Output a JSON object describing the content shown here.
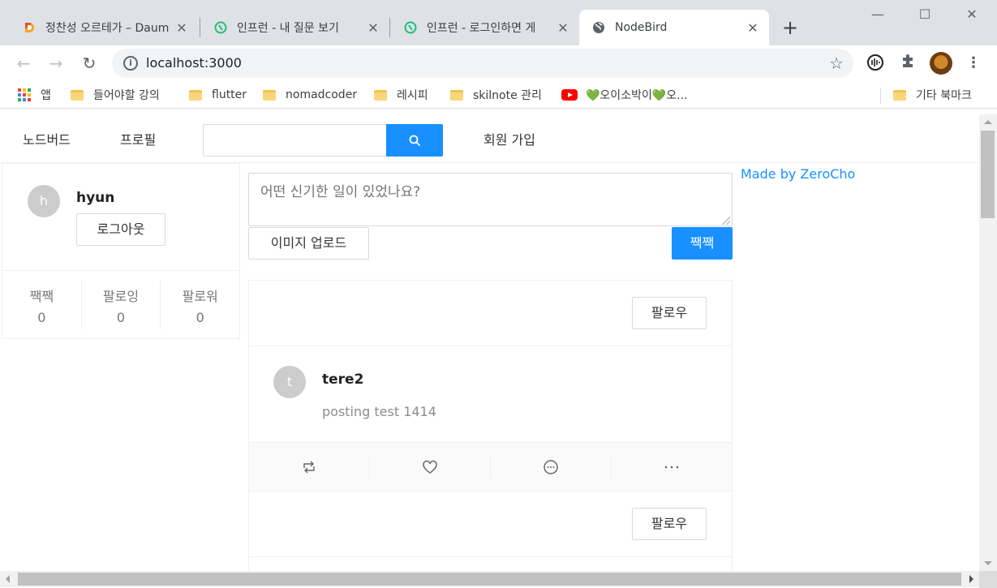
{
  "browser": {
    "tabs": [
      {
        "title": "정찬성 오르테가 – Daum",
        "favicon": "daum-icon"
      },
      {
        "title": "인프런 - 내 질문 보기",
        "favicon": "inflearn-icon"
      },
      {
        "title": "인프런 - 로그인하면 게",
        "favicon": "inflearn-icon"
      },
      {
        "title": "NodeBird",
        "favicon": "globe-icon"
      }
    ],
    "url": "localhost:3000",
    "bookmarks": [
      {
        "label": "앱",
        "icon": "apps-icon"
      },
      {
        "label": "들어야할 강의",
        "icon": "folder-icon"
      },
      {
        "label": "flutter",
        "icon": "folder-icon"
      },
      {
        "label": "nomadcoder",
        "icon": "folder-icon"
      },
      {
        "label": "레시피",
        "icon": "folder-icon"
      },
      {
        "label": "skilnote 관리",
        "icon": "folder-icon"
      },
      {
        "label": "💚오이소박이💚오...",
        "icon": "youtube-icon"
      },
      {
        "label": "기타 북마크",
        "icon": "folder-icon"
      }
    ]
  },
  "nav": {
    "home": "노드버드",
    "profile": "프로필",
    "signup": "회원 가입",
    "search_placeholder": ""
  },
  "profile": {
    "initial": "h",
    "nickname": "hyun",
    "logout": "로그아웃",
    "stats": [
      {
        "label": "짹짹",
        "value": "0"
      },
      {
        "label": "팔로잉",
        "value": "0"
      },
      {
        "label": "팔로워",
        "value": "0"
      }
    ]
  },
  "post_form": {
    "placeholder": "어떤 신기한 일이 있었나요?",
    "upload": "이미지 업로드",
    "submit": "짹짹"
  },
  "posts": [
    {
      "follow": "팔로우",
      "initial": "t",
      "author": "tere2",
      "content": "posting test 1414"
    },
    {
      "follow": "팔로우"
    }
  ],
  "footer_link": "Made by ZeroCho",
  "colors": {
    "accent": "#1890ff",
    "avatar": "#cccccc"
  }
}
